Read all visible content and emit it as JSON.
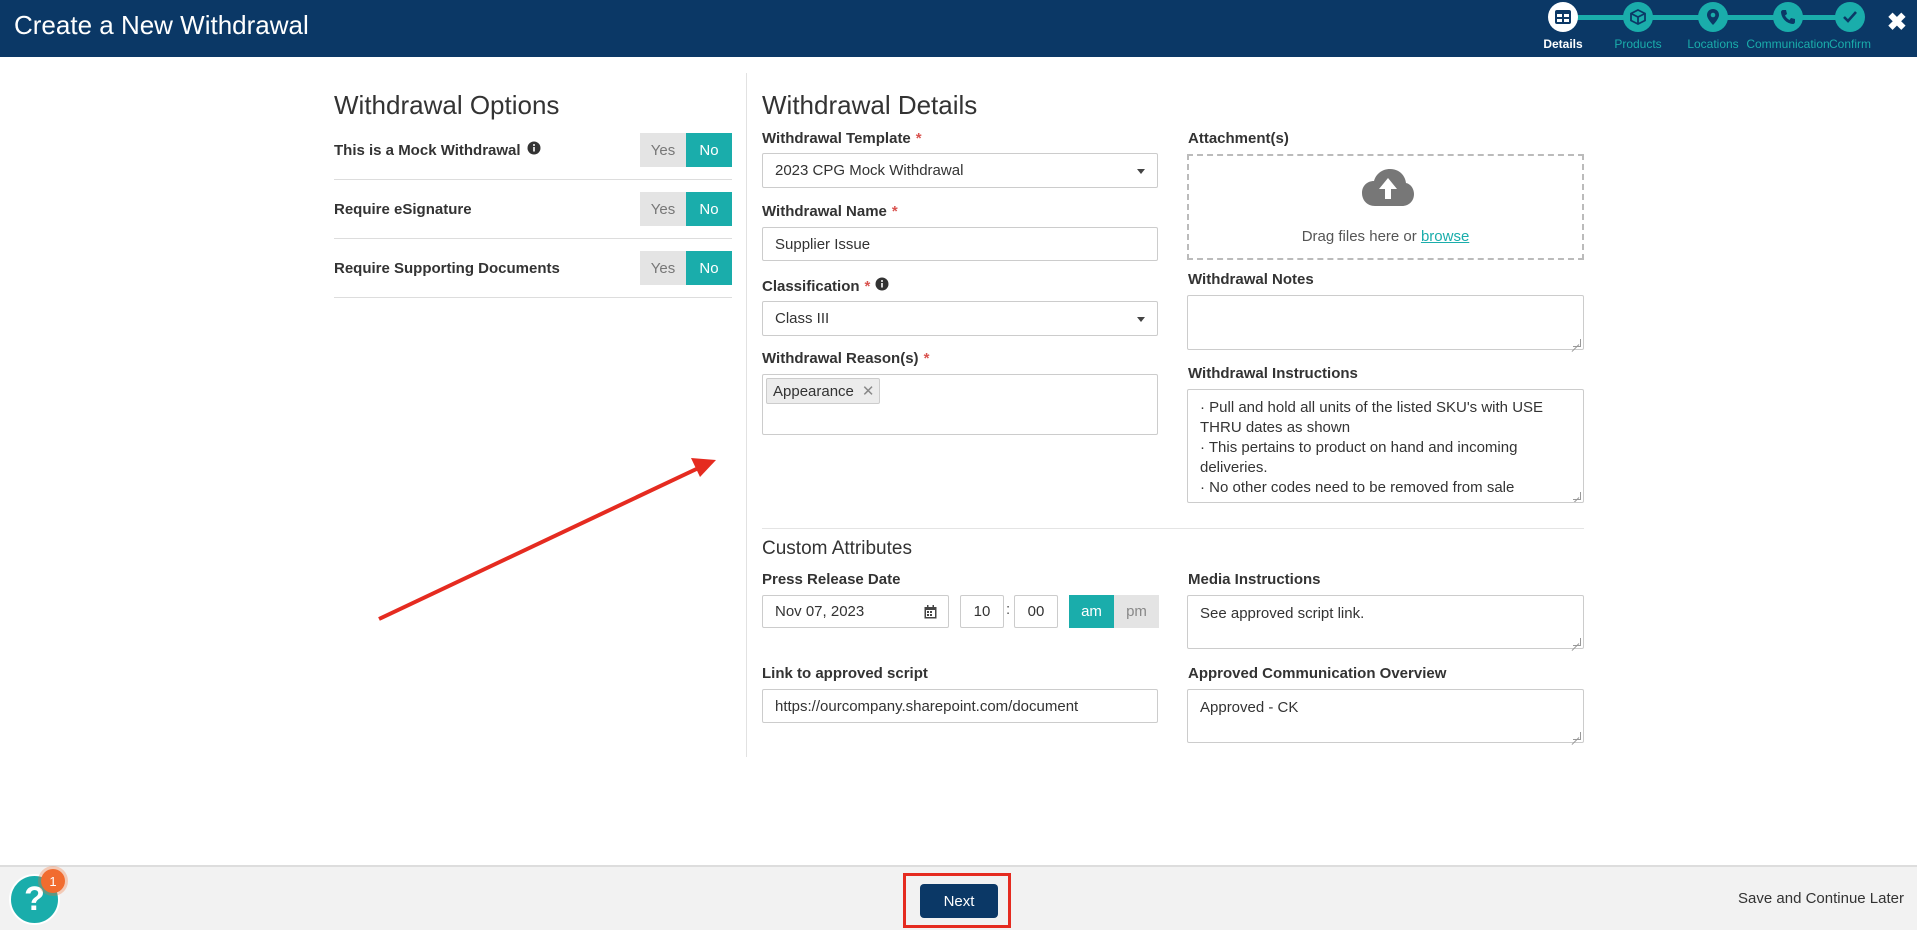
{
  "header": {
    "title": "Create a New Withdrawal",
    "steps": [
      {
        "label": "Details",
        "icon": "table-icon",
        "active": true
      },
      {
        "label": "Products",
        "icon": "box-icon",
        "active": false
      },
      {
        "label": "Locations",
        "icon": "map-pin-icon",
        "active": false
      },
      {
        "label": "Communication",
        "icon": "phone-icon",
        "active": false
      },
      {
        "label": "Confirm",
        "icon": "check-icon",
        "active": false
      }
    ]
  },
  "options": {
    "title": "Withdrawal Options",
    "items": [
      {
        "label": "This is a Mock Withdrawal",
        "yes": "Yes",
        "no": "No",
        "selected": "No"
      },
      {
        "label": "Require eSignature",
        "yes": "Yes",
        "no": "No",
        "selected": "No"
      },
      {
        "label": "Require Supporting Documents",
        "yes": "Yes",
        "no": "No",
        "selected": "No"
      }
    ]
  },
  "details": {
    "title": "Withdrawal Details",
    "template_label": "Withdrawal Template",
    "template_value": "2023 CPG Mock Withdrawal",
    "name_label": "Withdrawal Name",
    "name_value": "Supplier Issue",
    "classification_label": "Classification",
    "classification_value": "Class III",
    "reasons_label": "Withdrawal Reason(s)",
    "reasons": [
      "Appearance"
    ],
    "attachments_label": "Attachment(s)",
    "drag_text": "Drag files here or",
    "browse_text": "browse",
    "notes_label": "Withdrawal Notes",
    "notes_value": "",
    "instructions_label": "Withdrawal Instructions",
    "instructions_lines": [
      "· Pull and hold all units of the listed SKU's with USE THRU dates as shown",
      "· This pertains to product on hand and incoming deliveries.",
      "· No other codes need to be removed from sale"
    ]
  },
  "custom": {
    "title": "Custom Attributes",
    "press_label": "Press Release Date",
    "press_date": "Nov 07, 2023",
    "hour": "10",
    "colon": ":",
    "minute": "00",
    "am": "am",
    "pm": "pm",
    "period_selected": "am",
    "media_label": "Media Instructions",
    "media_value": "See approved script link.",
    "link_label": "Link to approved script",
    "link_value": "https://ourcompany.sharepoint.com/document",
    "overview_label": "Approved Communication Overview",
    "overview_value": "Approved - CK"
  },
  "footer": {
    "next": "Next",
    "save_later": "Save and Continue Later",
    "help_glyph": "?",
    "help_badge": "1"
  },
  "colors": {
    "header_bg": "#0b3866",
    "accent": "#1aadab",
    "required": "#d9534f",
    "annotation": "#e52b20"
  }
}
